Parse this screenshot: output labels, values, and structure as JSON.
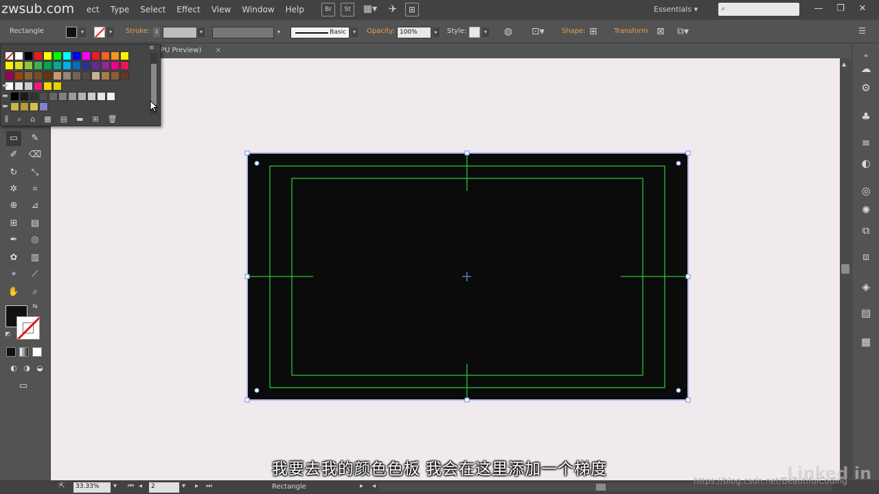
{
  "app": {
    "logo_text": "zwsub.com",
    "menus": [
      "ect",
      "Type",
      "Select",
      "Effect",
      "View",
      "Window",
      "Help"
    ],
    "bridge_buttons": [
      "Br",
      "St"
    ],
    "workspace": "Essentials",
    "workspace_caret": "▾"
  },
  "control_bar": {
    "tool_name": "Rectangle",
    "stroke_label": "Stroke:",
    "stroke_profile": "Basic",
    "opacity_label": "Opacity:",
    "opacity_value": "100%",
    "style_label": "Style:",
    "shape_label": "Shape:",
    "transform_label": "Transform",
    "fill_color": "#111111",
    "accent_orange": "#e8a050"
  },
  "document": {
    "tab_title": "PU Preview)",
    "tab_close": "×"
  },
  "swatches": {
    "rows": [
      [
        "none",
        "#ffffff",
        "#000000",
        "#ed1c24",
        "#ffff00",
        "#00ff00",
        "#00ffff",
        "#0000ff",
        "#ff00ff",
        "#ed1c24",
        "#f26522",
        "#f7941d",
        "#fff200"
      ],
      [
        "#fff200",
        "#d7df23",
        "#8dc63f",
        "#39b54a",
        "#00a651",
        "#00a99d",
        "#00aeef",
        "#0072bc",
        "#2e3192",
        "#662d91",
        "#92278f",
        "#ec008c",
        "#ed145b"
      ],
      [
        "#9e005d",
        "#a0410d",
        "#8c6239",
        "#754c24",
        "#603913",
        "#c69c6d",
        "#998675",
        "#736357",
        "#534741",
        "#c7b299",
        "#a67c52",
        "#8b5e3c",
        "#5b3a29"
      ],
      [
        "#ffffff",
        "#e6e6e6",
        "#cccccc",
        "#ed1c7a",
        "#fbd500",
        "#e8d000"
      ],
      [
        "#000000",
        "#1a1a1a",
        "#333333",
        "#4d4d4d",
        "#666666",
        "#808080",
        "#999999",
        "#b3b3b3",
        "#cccccc",
        "#e6e6e6",
        "#f2f2f2"
      ],
      [
        "#c8b44a",
        "#b89a3a",
        "#d4c04a",
        "#8a80d0"
      ]
    ]
  },
  "status_bar": {
    "zoom": "33.33%",
    "page": "2",
    "current_tool": "Rectangle"
  },
  "subtitle": "我要去我的颜色色板  我会在这里添加一个梯度",
  "watermark": "https://blog.csdn.net/BeautifulCoding",
  "brand": "Linked in"
}
